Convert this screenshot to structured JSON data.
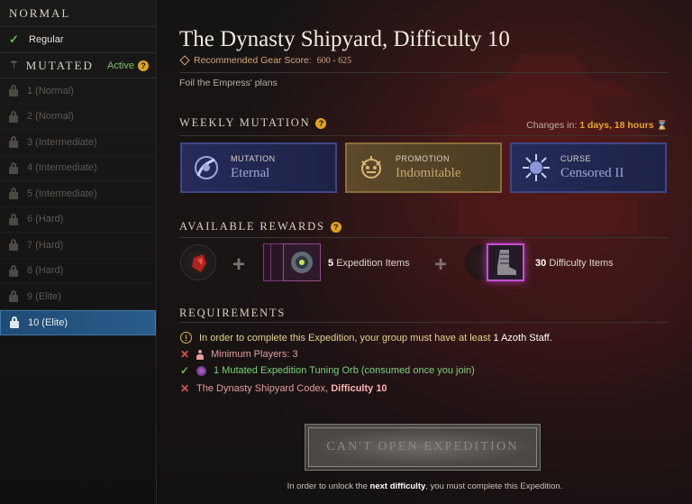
{
  "sidebar": {
    "normal_header": "NORMAL",
    "regular_label": "Regular",
    "mutated_header": "MUTATED",
    "active_label": "Active",
    "items": [
      {
        "label": "1 (Normal)"
      },
      {
        "label": "2 (Normal)"
      },
      {
        "label": "3 (Intermediate)"
      },
      {
        "label": "4 (Intermediate)"
      },
      {
        "label": "5 (Intermediate)"
      },
      {
        "label": "6 (Hard)"
      },
      {
        "label": "7 (Hard)"
      },
      {
        "label": "8 (Hard)"
      },
      {
        "label": "9 (Elite)"
      },
      {
        "label": "10 (Elite)"
      }
    ]
  },
  "header": {
    "title": "The Dynasty Shipyard, Difficulty 10",
    "gear_label": "Recommended Gear Score:",
    "gear_value": "600 - 625",
    "description": "Foil the Empress' plans"
  },
  "weekly": {
    "title": "WEEKLY MUTATION",
    "changes_label": "Changes in:",
    "changes_value": "1 days, 18 hours",
    "cards": [
      {
        "type": "MUTATION",
        "name": "Eternal"
      },
      {
        "type": "PROMOTION",
        "name": "Indomitable"
      },
      {
        "type": "CURSE",
        "name": "Censored II"
      }
    ]
  },
  "rewards": {
    "title": "AVAILABLE REWARDS",
    "expedition_count": "5",
    "expedition_label": "Expedition Items",
    "difficulty_count": "30",
    "difficulty_label": "Difficulty Items"
  },
  "requirements": {
    "title": "REQUIREMENTS",
    "weapon_text": "In order to complete this Expedition, your group must have at least",
    "weapon_value": "1 Azoth Staff.",
    "players": "Minimum Players: 3",
    "orb": "1 Mutated Expedition Tuning Orb (consumed once you join)",
    "codex_text": "The Dynasty Shipyard Codex,",
    "codex_value": "Difficulty 10"
  },
  "action": {
    "button_label": "CAN'T OPEN EXPEDITION",
    "unlock_pre": "In order to unlock the",
    "unlock_bold": "next difficulty",
    "unlock_post": ", you must complete this Expedition."
  },
  "colors": {
    "accent_gold": "#e5a827",
    "selected_blue": "#2a5d8c",
    "error_red": "#e0564c",
    "success_green": "#5cbf4a"
  },
  "icons": [
    "check-icon",
    "mutation-icon",
    "help-icon",
    "lock-icon",
    "gear-diamond-icon",
    "hourglass-icon",
    "plus-icon",
    "warning-icon",
    "x-icon",
    "person-icon",
    "orb-icon"
  ]
}
